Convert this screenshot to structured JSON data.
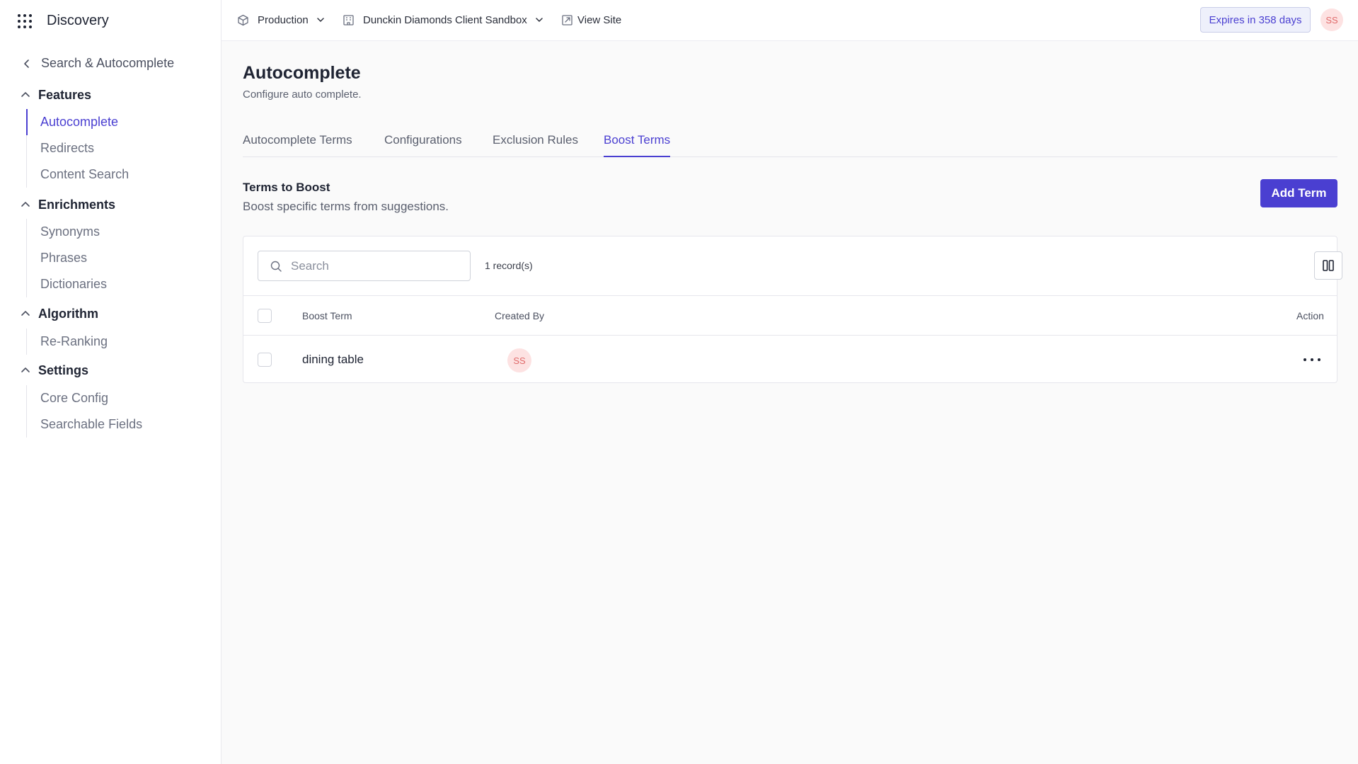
{
  "app": {
    "name": "Discovery"
  },
  "sidebar": {
    "back_label": "Search & Autocomplete",
    "groups": [
      {
        "label": "Features",
        "items": [
          {
            "label": "Autocomplete"
          },
          {
            "label": "Redirects"
          },
          {
            "label": "Content Search"
          }
        ]
      },
      {
        "label": "Enrichments",
        "items": [
          {
            "label": "Synonyms"
          },
          {
            "label": "Phrases"
          },
          {
            "label": "Dictionaries"
          }
        ]
      },
      {
        "label": "Algorithm",
        "items": [
          {
            "label": "Re-Ranking"
          }
        ]
      },
      {
        "label": "Settings",
        "items": [
          {
            "label": "Core Config"
          },
          {
            "label": "Searchable Fields"
          }
        ]
      }
    ],
    "active_item": "Autocomplete"
  },
  "topbar": {
    "environment": "Production",
    "client": "Dunckin Diamonds Client Sandbox",
    "view_site": "View Site",
    "expires": "Expires in 358 days",
    "user_initials": "SS"
  },
  "page": {
    "title": "Autocomplete",
    "subtitle": "Configure auto complete.",
    "tabs": [
      {
        "label": "Autocomplete Terms"
      },
      {
        "label": "Configurations"
      },
      {
        "label": "Exclusion Rules"
      },
      {
        "label": "Boost Terms"
      }
    ],
    "active_tab": "Boost Terms"
  },
  "section": {
    "title": "Terms to Boost",
    "subtitle": "Boost specific terms from suggestions.",
    "add_button": "Add Term"
  },
  "table": {
    "search_placeholder": "Search",
    "record_count": "1 record(s)",
    "columns": {
      "term": "Boost Term",
      "created_by": "Created By",
      "action": "Action"
    },
    "rows": [
      {
        "term": "dining table",
        "created_by_initials": "SS"
      }
    ]
  },
  "colors": {
    "accent": "#4a3fd1",
    "avatar_bg": "#fde2e2",
    "avatar_text": "#e06a6a"
  }
}
